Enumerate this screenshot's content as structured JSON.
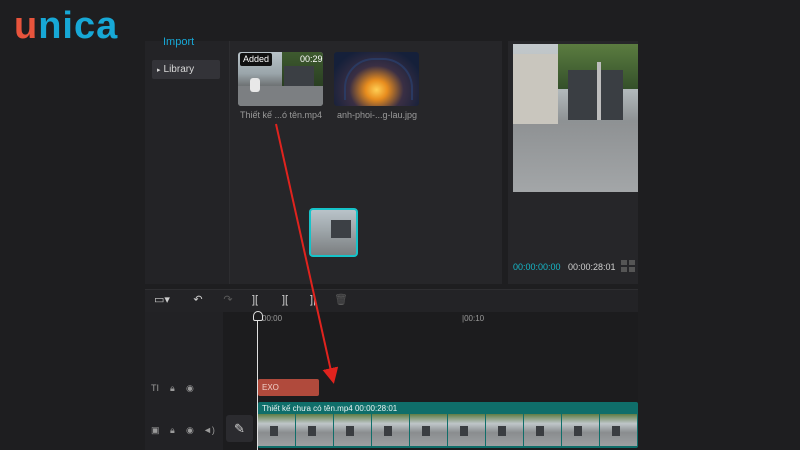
{
  "logo": {
    "first": "u",
    "rest": "nica"
  },
  "media": {
    "import_label": "Import",
    "library_label": "Library",
    "items": [
      {
        "badge": "Added",
        "duration": "00:29",
        "filename": "Thiết kế ...ó tên.mp4"
      },
      {
        "filename": "anh-phoi-...g-lau.jpg"
      }
    ]
  },
  "player": {
    "current_time": "00:00:00:00",
    "total_time": "00:00:28:01"
  },
  "timeline": {
    "ruler_labels": [
      "00:00",
      "|00:10"
    ],
    "text_clip_label": "EXO",
    "video_clip_label": "Thiết kế chưa có tên.mp4   00:00:28:01"
  },
  "colors": {
    "accent": "#16b8c9",
    "text_clip": "#b04a3c",
    "video_clip": "#0f6e6a",
    "arrow": "#e0231e"
  }
}
